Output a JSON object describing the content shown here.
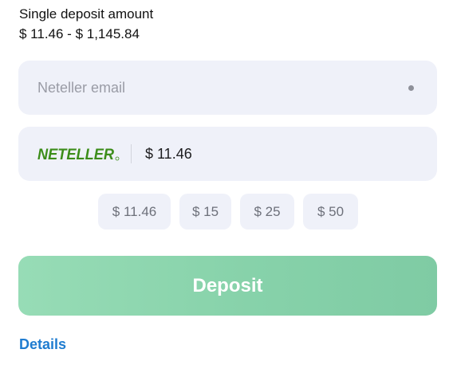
{
  "limits": {
    "label": "Single deposit amount",
    "range": "$ 11.46 - $ 1,145.84"
  },
  "email_field": {
    "placeholder": "Neteller email",
    "value": ""
  },
  "amount_field": {
    "provider_logo": "NETELLER",
    "value": "$ 11.46"
  },
  "presets": [
    {
      "label": "$ 11.46"
    },
    {
      "label": "$ 15"
    },
    {
      "label": "$ 25"
    },
    {
      "label": "$ 50"
    }
  ],
  "deposit_button": {
    "label": "Deposit"
  },
  "details_link": {
    "label": "Details"
  },
  "colors": {
    "field_background": "#eff1f9",
    "deposit_button_start": "#97dcb6",
    "deposit_button_end": "#7fcba4",
    "link": "#1f7cd0",
    "neteller_green": "#3c8d1a"
  }
}
